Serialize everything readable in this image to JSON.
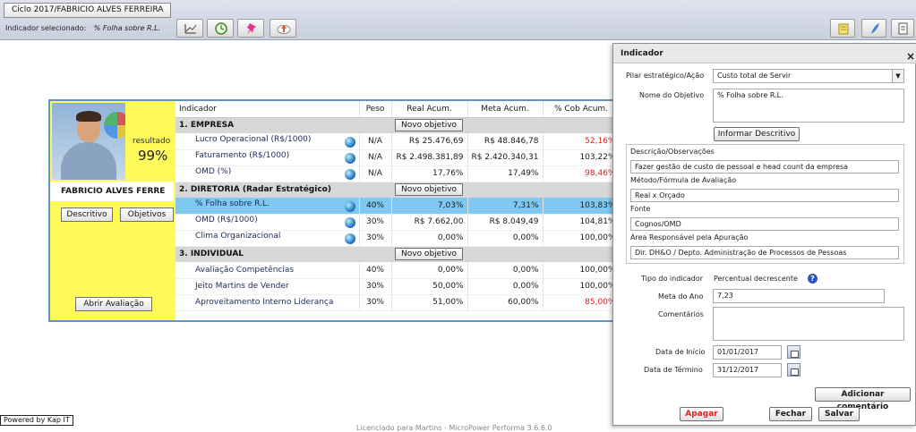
{
  "header": {
    "cycle": "Ciclo 2017/FABRICIO ALVES FERREIRA",
    "selected_label": "Indicador selecionado:",
    "selected_value": "% Folha sobre R.L.",
    "toolbar_icons": [
      "chart-icon",
      "clock-icon",
      "pin-icon",
      "upload-icon"
    ],
    "right_icons": [
      "notes-icon",
      "feather-icon",
      "document-icon"
    ]
  },
  "profile": {
    "result_label": "resultado",
    "result_value": "99%",
    "name": "FABRICIO ALVES FERRE",
    "descritivo_btn": "Descritivo",
    "objetivos_btn": "Objetivos",
    "abrir_btn": "Abrir Avaliação"
  },
  "table": {
    "columns": [
      "Indicador",
      "Peso",
      "Real Acum.",
      "Meta Acum.",
      "% Cob Acum."
    ],
    "new_objective_label": "Novo objetivo",
    "sections": [
      {
        "title": "1. EMPRESA",
        "rows": [
          {
            "name": "Lucro Operacional (R$/1000)",
            "peso": "N/A",
            "real": "R$ 25.476,69",
            "meta": "R$ 48.846,78",
            "cob": "52,16%",
            "cob_red": true,
            "globe": true
          },
          {
            "name": "Faturamento (R$/1000)",
            "peso": "N/A",
            "real": "R$ 2.498.381,89",
            "meta": "R$ 2.420.340,31",
            "cob": "103,22%",
            "cob_red": false,
            "globe": true
          },
          {
            "name": "OMD (%)",
            "peso": "N/A",
            "real": "17,76%",
            "meta": "17,49%",
            "cob": "98,46%",
            "cob_red": true,
            "globe": true
          }
        ]
      },
      {
        "title": "2. DIRETORIA (Radar Estratégico)",
        "rows": [
          {
            "name": "% Folha sobre R.L.",
            "peso": "40%",
            "real": "7,03%",
            "meta": "7,31%",
            "cob": "103,83%",
            "cob_red": false,
            "globe": true,
            "selected": true
          },
          {
            "name": "OMD (R$/1000)",
            "peso": "30%",
            "real": "R$ 7.662,00",
            "meta": "R$ 8.049,49",
            "cob": "104,81%",
            "cob_red": false,
            "globe": true
          },
          {
            "name": "Clima Organizacional",
            "peso": "30%",
            "real": "0,00%",
            "meta": "0,00%",
            "cob": "100,00%",
            "cob_red": false,
            "globe": true
          }
        ]
      },
      {
        "title": "3. INDIVIDUAL",
        "rows": [
          {
            "name": "Avaliação Competências",
            "peso": "40%",
            "real": "0,00%",
            "meta": "0,00%",
            "cob": "100,00%",
            "cob_red": false,
            "globe": false
          },
          {
            "name": "Jeito Martins de Vender",
            "peso": "30%",
            "real": "50,00%",
            "meta": "0,00%",
            "cob": "100,00%",
            "cob_red": false,
            "globe": false
          },
          {
            "name": "Aproveitamento Interno Liderança",
            "peso": "30%",
            "real": "51,00%",
            "meta": "60,00%",
            "cob": "85,00%",
            "cob_red": true,
            "globe": false
          }
        ]
      }
    ]
  },
  "dialog": {
    "title": "Indicador",
    "close": "×",
    "pilar_label": "Pilar estratégico/Ação",
    "pilar_value": "Custo total de Servir",
    "objetivo_label": "Nome do Objetivo",
    "objetivo_value": "% Folha sobre R.L.",
    "informar_btn": "Informar Descritivo",
    "descricao_label": "Descrição/Observações",
    "descricao_value": "Fazer gestão de custo de pessoal e head count da empresa",
    "metodo_label": "Método/Fórmula de Avaliação",
    "metodo_value": "Real x Orçado",
    "fonte_label": "Fonte",
    "fonte_value": "Cognos/OMD",
    "area_label": "Área Responsável pela Apuração",
    "area_value": "Dir. DH&O / Depto. Administração de Processos de Pessoas",
    "tipo_label": "Tipo do indicador",
    "tipo_value": "Percentual decrescente",
    "help": "?",
    "meta_label": "Meta do Ano",
    "meta_value": "7,23",
    "comentarios_label": "Comentários",
    "inicio_label": "Data de Início",
    "inicio_value": "01/01/2017",
    "termino_label": "Data de Término",
    "termino_value": "31/12/2017",
    "add_comment_btn": "Adicionar comentário",
    "apagar_btn": "Apagar",
    "fechar_btn": "Fechar",
    "salvar_btn": "Salvar",
    "apagar_color": "#e02020"
  },
  "footer": {
    "powered": "Powered by Kap IT",
    "license": "Licenciado para Martins - MicroPower Performa 3.6.6.0"
  }
}
